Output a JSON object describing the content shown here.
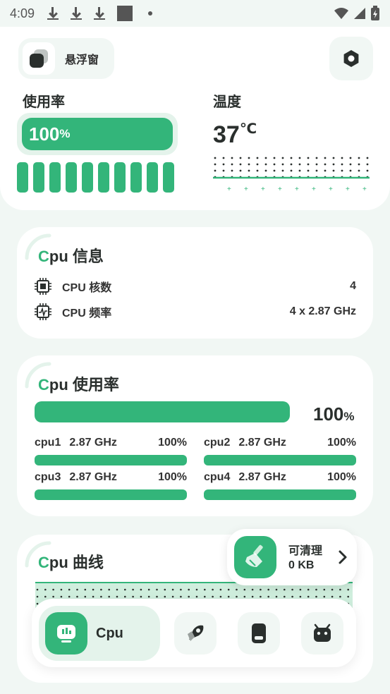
{
  "status_bar": {
    "time": "4:09"
  },
  "header": {
    "float_window_label": "悬浮窗"
  },
  "usage": {
    "title": "使用率",
    "value": "100",
    "unit": "%",
    "level": 1.0,
    "segment_count": 10
  },
  "temperature": {
    "title": "温度",
    "value": "37",
    "unit": "℃"
  },
  "cpu_info": {
    "title_first": "C",
    "title_rest": "pu 信息",
    "rows": [
      {
        "label": "CPU 核数",
        "value": "4",
        "icon": "cpu-chip-icon"
      },
      {
        "label": "CPU 频率",
        "value": "4 x 2.87 GHz",
        "icon": "cpu-frequency-icon"
      }
    ]
  },
  "cpu_usage": {
    "title_first": "C",
    "title_rest": "pu 使用率",
    "total": "100",
    "unit": "%",
    "total_level": 1.0,
    "cores": [
      {
        "name": "cpu1",
        "freq": "2.87 GHz",
        "pct": "100%",
        "level": 1.0
      },
      {
        "name": "cpu2",
        "freq": "2.87 GHz",
        "pct": "100%",
        "level": 1.0
      },
      {
        "name": "cpu3",
        "freq": "2.87 GHz",
        "pct": "100%",
        "level": 1.0
      },
      {
        "name": "cpu4",
        "freq": "2.87 GHz",
        "pct": "100%",
        "level": 1.0
      }
    ]
  },
  "cpu_curve": {
    "title_first": "C",
    "title_rest": "pu 曲线"
  },
  "cleaner": {
    "label": "可清理",
    "size": "0 KB"
  },
  "nav": {
    "active_label": "Cpu",
    "tabs": [
      "cpu-tab",
      "rocket-tab",
      "battery-tab",
      "android-tab"
    ]
  },
  "colors": {
    "accent": "#33b57a",
    "accent_light": "#e4f3eb",
    "background": "#f1f7f4"
  }
}
